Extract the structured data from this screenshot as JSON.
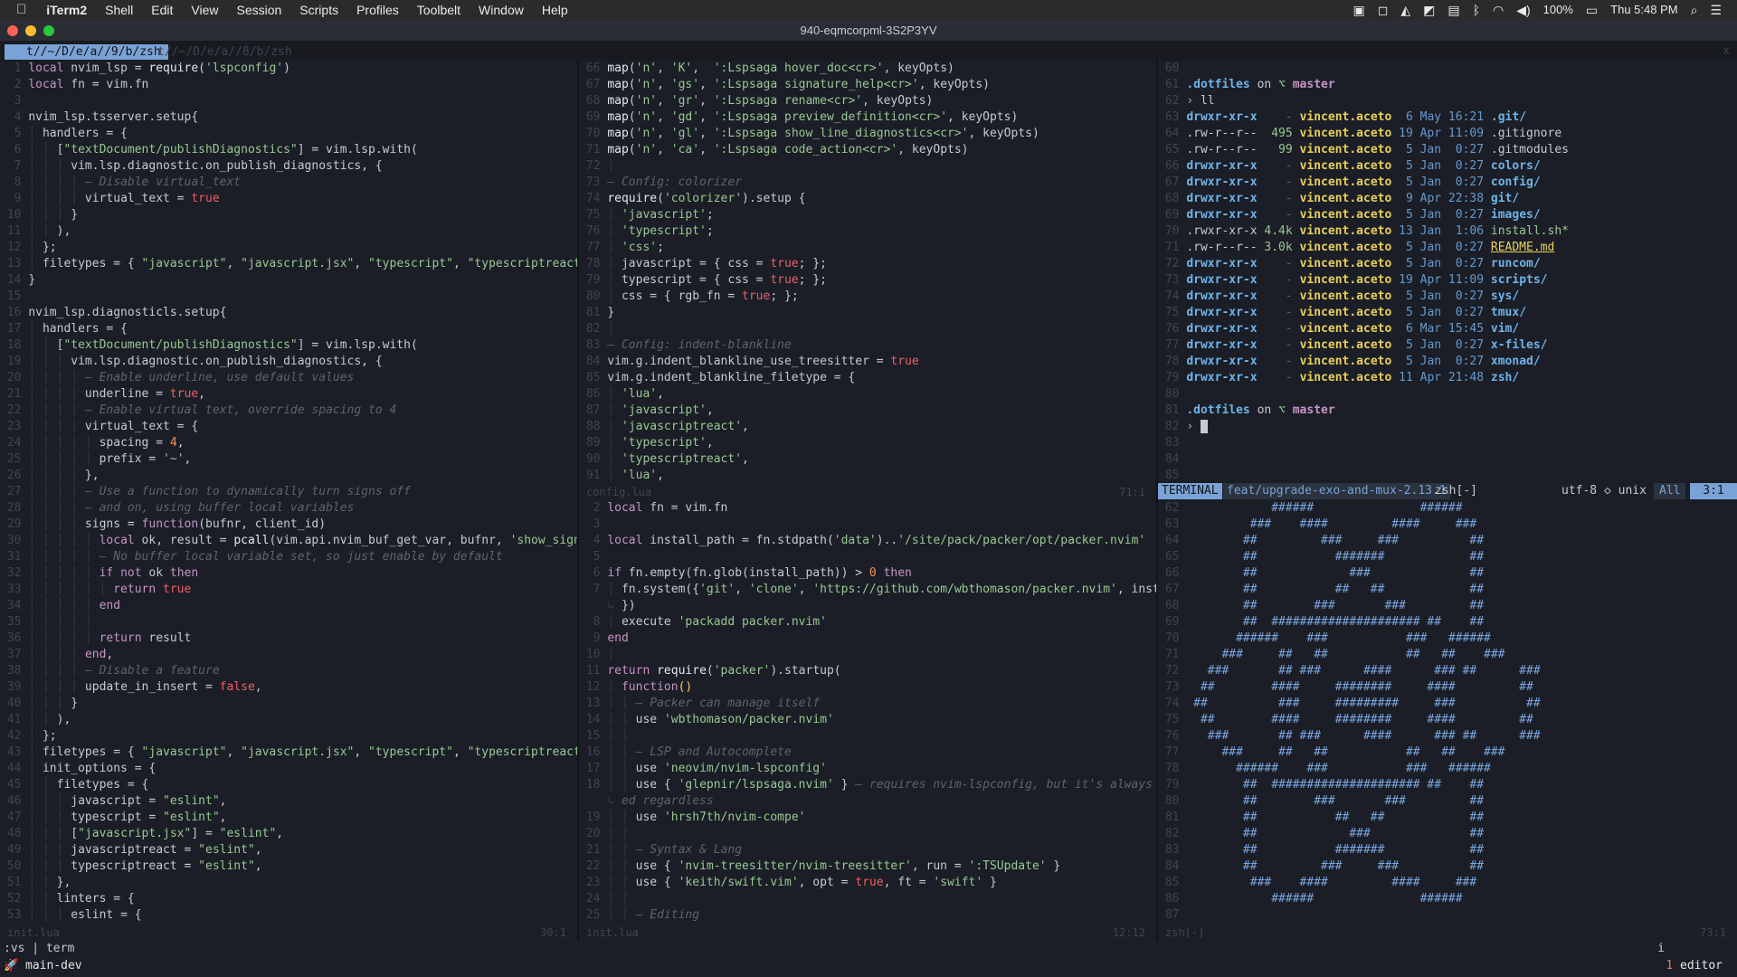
{
  "menubar": {
    "apple": "",
    "items": [
      "iTerm2",
      "Shell",
      "Edit",
      "View",
      "Session",
      "Scripts",
      "Profiles",
      "Toolbelt",
      "Window",
      "Help"
    ],
    "status": {
      "battery": "100%",
      "clock": "Thu 5:48 PM"
    }
  },
  "window": {
    "title": "940-eqmcorpml-3S2P3YV"
  },
  "tabs": {
    "active": "t//~/D/e/a//9/b/zsh",
    "inactive": "t//~/D/e/a//8/b/zsh",
    "close": "x"
  },
  "panes": {
    "left_status": {
      "file": "init.lua",
      "pos": "30:1"
    },
    "mid_top_status": {
      "file": "config.lua",
      "pos": "71:1"
    },
    "mid_bottom_status": {
      "file": "init.lua",
      "pos": "12:12"
    },
    "right_bottom_status": {
      "file": "zsh[-]",
      "pos": "73:1"
    }
  },
  "terminal_status": {
    "mode": "TERMINAL",
    "branch": "feat/upgrade-exo-and-mux-2.13.1",
    "buffer": "zsh[-]",
    "encoding": "utf-8 ◇ unix",
    "scroll": "All",
    "pos": "3:1"
  },
  "cmdline": {
    "command": ":vs | term",
    "cursor": "i"
  },
  "tmux": {
    "session": "main-dev",
    "window_num": "1",
    "window_name": "editor"
  },
  "colors": {
    "accent": "#7aa2d6",
    "background": "#1b1e26",
    "keyword": "#c594c5",
    "string": "#99c794",
    "number": "#f99157",
    "comment": "#5c6370"
  }
}
